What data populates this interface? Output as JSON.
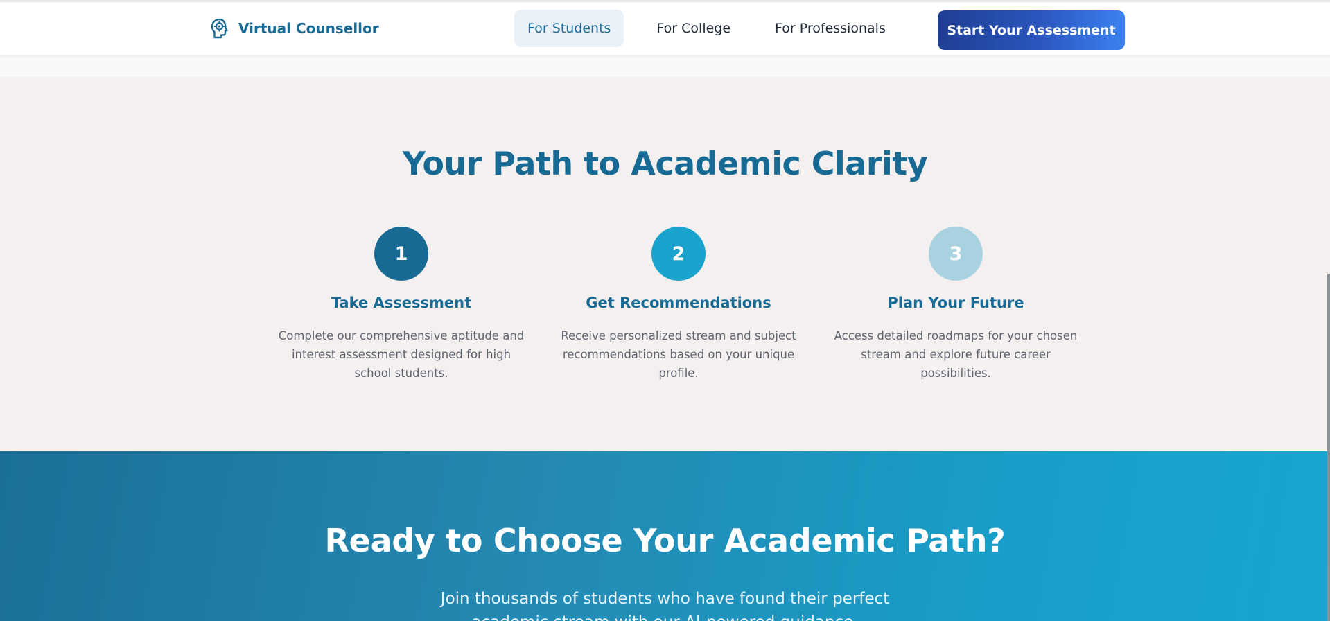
{
  "header": {
    "brand_name": "Virtual Counsellor",
    "brand_icon": "head-gear-icon",
    "nav": [
      {
        "label": "For Students",
        "active": true
      },
      {
        "label": "For College",
        "active": false
      },
      {
        "label": "For Professionals",
        "active": false
      }
    ],
    "cta_label": "Start Your Assessment"
  },
  "steps_section": {
    "title": "Your Path to Academic Clarity",
    "steps": [
      {
        "number": "1",
        "title": "Take Assessment",
        "description": "Complete our comprehensive aptitude and interest assessment designed for high school students.",
        "color": "#176a93"
      },
      {
        "number": "2",
        "title": "Get Recommendations",
        "description": "Receive personalized stream and subject recommendations based on your unique profile.",
        "color": "#1aa3cc"
      },
      {
        "number": "3",
        "title": "Plan Your Future",
        "description": "Access detailed roadmaps for your chosen stream and explore future career possibilities.",
        "color": "#a9d2e1"
      }
    ]
  },
  "cta_section": {
    "title": "Ready to Choose Your Academic Path?",
    "subtitle": "Join thousands of students who have found their perfect academic stream with our AI-powered guidance."
  },
  "colors": {
    "brand": "#176a93",
    "cta_gradient_start": "#1e3e93",
    "cta_gradient_end": "#3b82f0"
  }
}
